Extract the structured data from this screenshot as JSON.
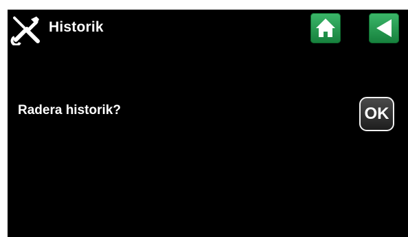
{
  "header": {
    "title": "Historik",
    "tools_icon": "tools-icon",
    "home_icon": "home-icon",
    "back_icon": "back-arrow-icon"
  },
  "dialog": {
    "question": "Radera historik?",
    "ok_label": "OK"
  },
  "colors": {
    "background": "#000000",
    "accent_green": "#2a9d52",
    "text": "#ffffff"
  }
}
